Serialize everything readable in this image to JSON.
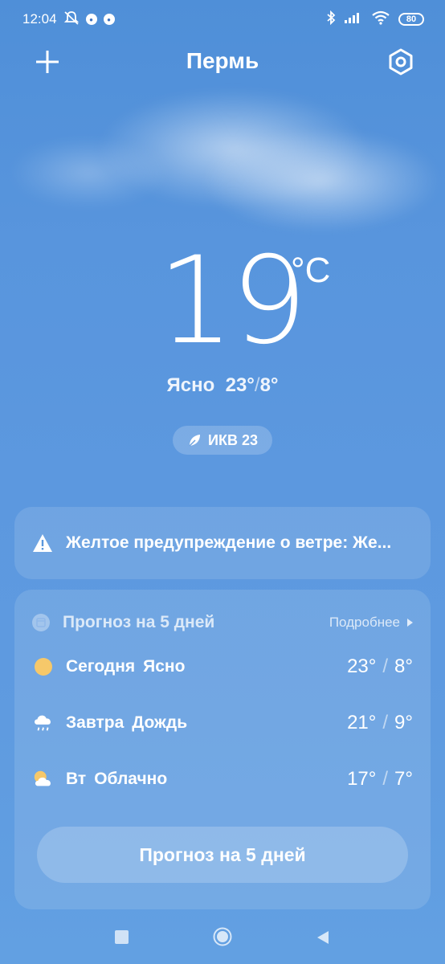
{
  "status_bar": {
    "time": "12:04",
    "battery": "80",
    "icons": [
      "mute-icon",
      "app-notification-icon",
      "app-notification-icon",
      "bluetooth-icon",
      "signal-icon",
      "wifi-icon",
      "battery-icon"
    ]
  },
  "header": {
    "city": "Пермь",
    "add_icon": "plus-icon",
    "settings_icon": "settings-icon"
  },
  "current": {
    "temperature": "19",
    "unit": "°C",
    "condition": "Ясно",
    "high": "23°",
    "low": "8°",
    "aqi_label": "ИКВ 23",
    "aqi_icon": "leaf-icon"
  },
  "warning": {
    "icon": "warning-icon",
    "text": "Желтое предупреждение о ветре: Же..."
  },
  "forecast": {
    "title": "Прогноз на 5 дней",
    "details_label": "Подробнее",
    "days": [
      {
        "day": "Сегодня",
        "condition": "Ясно",
        "high": "23°",
        "low": "8°",
        "icon": "sun-icon"
      },
      {
        "day": "Завтра",
        "condition": "Дождь",
        "high": "21°",
        "low": "9°",
        "icon": "rain-cloud-icon"
      },
      {
        "day": "Вт",
        "condition": "Облачно",
        "high": "17°",
        "low": "7°",
        "icon": "partly-cloudy-icon"
      }
    ],
    "button_label": "Прогноз на 5 дней"
  },
  "colors": {
    "background": "#5a97dd",
    "sun": "#f6c86a"
  }
}
